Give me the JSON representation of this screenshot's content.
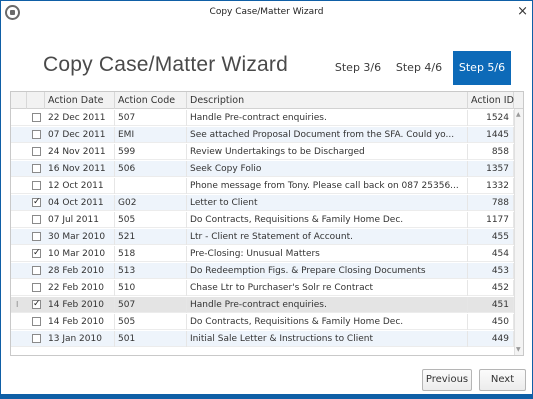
{
  "window": {
    "title": "Copy Case/Matter Wizard",
    "close_glyph": "×",
    "app_icon": "app-logo-icon"
  },
  "wizard": {
    "heading": "Copy Case/Matter Wizard",
    "steps": [
      {
        "label": "Step 3/6",
        "active": false
      },
      {
        "label": "Step 4/6",
        "active": false
      },
      {
        "label": "Step 5/6",
        "active": true
      }
    ]
  },
  "grid": {
    "columns": [
      "",
      "",
      "Action Date",
      "Action Code",
      "Description",
      "Action ID"
    ],
    "rows": [
      {
        "checked": false,
        "date": "22 Dec 2011",
        "code": "507",
        "description": "Handle Pre-contract enquiries.",
        "id": "1524",
        "current": false
      },
      {
        "checked": false,
        "date": "07 Dec 2011",
        "code": "EMI",
        "description": "See attached Proposal Document from the SFA. Could yo...",
        "id": "1445",
        "current": false
      },
      {
        "checked": false,
        "date": "24 Nov 2011",
        "code": "599",
        "description": "Review Undertakings to be Discharged",
        "id": "858",
        "current": false
      },
      {
        "checked": false,
        "date": "16 Nov 2011",
        "code": "506",
        "description": "Seek Copy Folio",
        "id": "1357",
        "current": false
      },
      {
        "checked": false,
        "date": "12 Oct 2011",
        "code": "",
        "description": "Phone message from Tony. Please call back on 087 25356...",
        "id": "1332",
        "current": false
      },
      {
        "checked": true,
        "date": "04 Oct 2011",
        "code": "G02",
        "description": "Letter to Client",
        "id": "788",
        "current": false
      },
      {
        "checked": false,
        "date": "07 Jul 2011",
        "code": "505",
        "description": "Do Contracts, Requisitions & Family Home Dec.",
        "id": "1177",
        "current": false
      },
      {
        "checked": false,
        "date": "30 Mar 2010",
        "code": "521",
        "description": "Ltr - Client re Statement of Account.",
        "id": "455",
        "current": false
      },
      {
        "checked": true,
        "date": "10 Mar 2010",
        "code": "518",
        "description": "Pre-Closing: Unusual Matters",
        "id": "454",
        "current": false
      },
      {
        "checked": false,
        "date": "28 Feb 2010",
        "code": "513",
        "description": "Do Redeemption Figs. & Prepare Closing Documents",
        "id": "453",
        "current": false
      },
      {
        "checked": false,
        "date": "22 Feb 2010",
        "code": "510",
        "description": "Chase Ltr to Purchaser's Solr re Contract",
        "id": "452",
        "current": false
      },
      {
        "checked": true,
        "date": "14 Feb 2010",
        "code": "507",
        "description": "Handle Pre-contract enquiries.",
        "id": "451",
        "current": true
      },
      {
        "checked": false,
        "date": "14 Feb 2010",
        "code": "505",
        "description": "Do Contracts, Requisitions & Family Home Dec.",
        "id": "450",
        "current": false
      },
      {
        "checked": false,
        "date": "13 Jan 2010",
        "code": "501",
        "description": "Initial Sale Letter & Instructions to Client",
        "id": "449",
        "current": false
      }
    ],
    "current_row_marker": "I"
  },
  "buttons": {
    "previous": "Previous",
    "next": "Next"
  },
  "colors": {
    "accent": "#0d6ab8",
    "alt_row": "#eef4fb",
    "selected_row": "#e4e4e4"
  }
}
